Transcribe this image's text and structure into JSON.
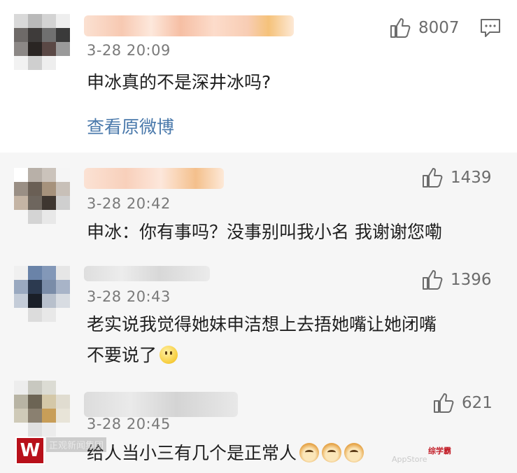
{
  "main_comment": {
    "time": "3-28 20:09",
    "like_count": "8007",
    "text": "申冰真的不是深井冰吗?",
    "view_original_link": "查看原微博"
  },
  "replies": [
    {
      "time": "3-28 20:42",
      "like_count": "1439",
      "text": "申冰：你有事吗？没事别叫我小名 我谢谢您嘞"
    },
    {
      "time": "3-28 20:43",
      "like_count": "1396",
      "text_line1": "老实说我觉得她妹申洁想上去捂她嘴让她闭嘴",
      "text_line2": "不要说了"
    },
    {
      "time": "3-28 20:45",
      "like_count": "621",
      "text": "给人当小三有几个是正常人"
    }
  ],
  "watermark": {
    "logo_letter": "W",
    "left_text": "正观新闻集团",
    "right_text": "综学霸",
    "right_sub": "AppStore"
  },
  "icons": {
    "like": "thumbs-up-icon",
    "comment": "comment-icon",
    "smile_emoji": "smile-emoji-icon",
    "doge_emoji": "doge-emoji-icon"
  },
  "colors": {
    "link": "#4a79ab",
    "time": "#7a7a7a",
    "text": "#1f1f1f",
    "background": "#f6f6f6"
  }
}
